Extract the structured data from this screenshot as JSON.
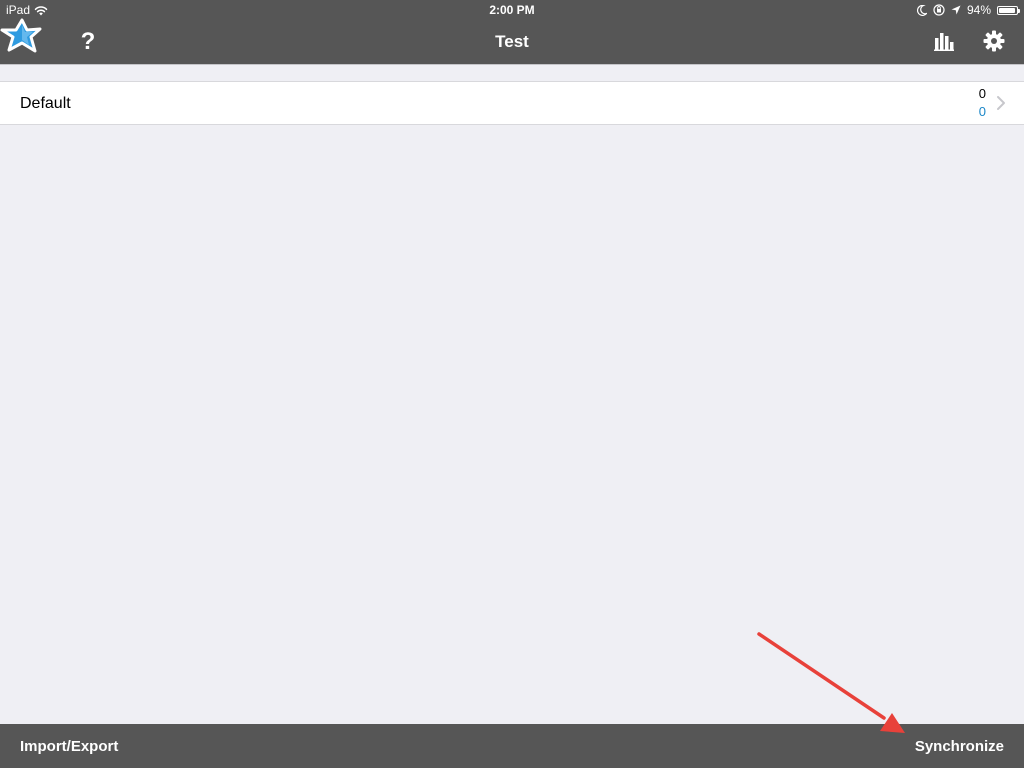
{
  "status_bar": {
    "device": "iPad",
    "time": "2:00 PM",
    "battery_percent": "94%",
    "battery_level": 0.94,
    "icons": [
      "wifi-icon",
      "moon-icon",
      "rotation-lock-icon",
      "location-arrow-icon",
      "battery-icon"
    ]
  },
  "nav": {
    "title": "Test",
    "help_label": "?",
    "icons": [
      "anki-star-logo-icon",
      "help-icon",
      "bar-chart-icon",
      "gear-icon"
    ]
  },
  "decks": [
    {
      "name": "Default",
      "new_count": "0",
      "due_count": "0"
    }
  ],
  "bottom": {
    "import_label": "Import/Export",
    "sync_label": "Synchronize"
  },
  "colors": {
    "bar": "#565656",
    "background": "#efeff4",
    "due_blue": "#1b87c8",
    "annotation_red": "#e8413a",
    "logo_blue": "#2f9be0"
  }
}
